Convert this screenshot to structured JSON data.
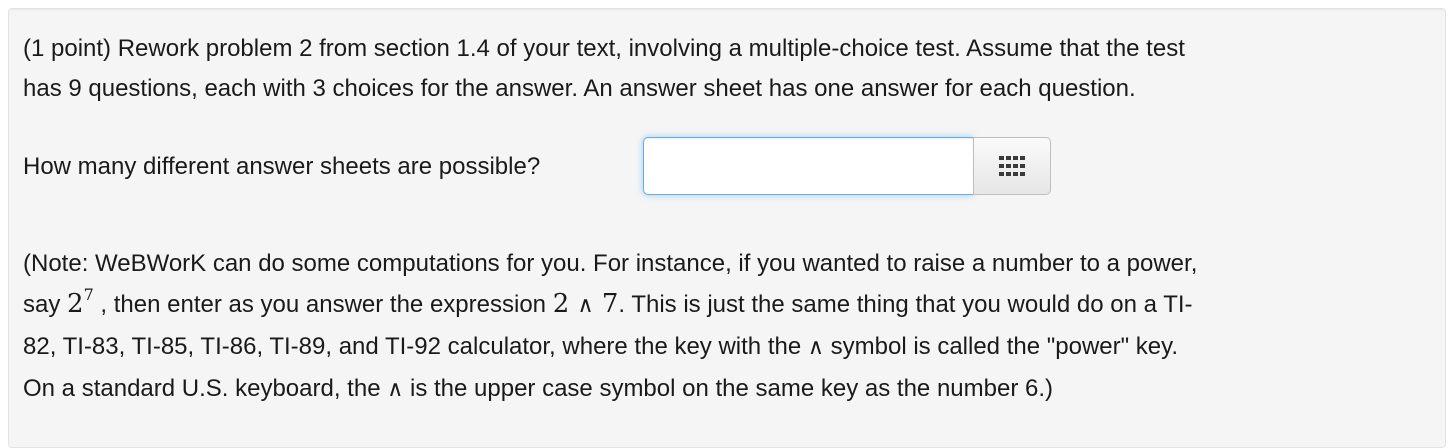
{
  "problem": {
    "intro_line1": "(1 point) Rework problem 2 from section 1.4 of your text, involving a multiple-choice test. Assume that the test",
    "intro_line2": "has 9 questions, each with 3 choices for the answer. An answer sheet has one answer for each question.",
    "question": "How many different answer sheets are possible?",
    "answer_value": "",
    "equation_button_icon": "grid-icon",
    "note": {
      "line1": "(Note: WeBWorK can do some computations for you. For instance, if you wanted to raise a number to a power,",
      "line2_a": "say ",
      "example_base": "2",
      "example_exp": "7",
      "line2_b": " , then enter as you answer the expression ",
      "expr_left": "2",
      "caret_symbol": "∧",
      "expr_right": "7",
      "line2_c": ". This is just the same thing that you would do on a TI-",
      "line3_a": "82, TI-83, TI-85, TI-86, TI-89, and TI-92 calculator, where the key with the ",
      "line3_b": " symbol is called the \"power\" key.",
      "line4_a": "On a standard U.S. keyboard, the ",
      "line4_b": " is the upper case symbol on the same key as the number 6.)"
    }
  },
  "colors": {
    "panel_bg": "#f5f5f5",
    "input_focus_border": "#66afe9",
    "text": "#1a1a1a"
  }
}
